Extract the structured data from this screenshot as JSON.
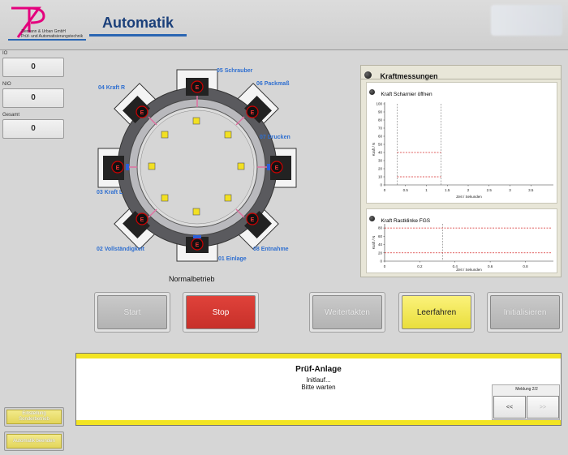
{
  "header": {
    "title": "Automatik",
    "company_line1": "Ziemann & Urban GmbH",
    "company_line2": "Prüf- und Automatisierungstechnik",
    "logo_letters": "ZU",
    "brand_color": "#e4007d",
    "accent_color": "#2a66b3"
  },
  "counters": [
    {
      "label": "IO",
      "value": "0"
    },
    {
      "label": "NIO",
      "value": "0"
    },
    {
      "label": "Gesamt",
      "value": "0"
    }
  ],
  "stations": {
    "s01": "01 Einlage",
    "s02": "02 Vollständigkeit",
    "s03": "03 Kraft L",
    "s04": "04 Kraft R",
    "s05": "05 Schrauber",
    "s06": "06 Packmaß",
    "s07": "07 Drucken",
    "s08": "08 Entnahme",
    "marker": "E"
  },
  "mode": "Normalbetrieb",
  "charts_panel": {
    "title": "Kraftmessungen",
    "chart1": {
      "title": "Kraft Scharnier öffnen",
      "ylabel": "Kraft / N",
      "xlabel": "Zeit / Sekunden",
      "yticks": [
        "100",
        "90",
        "80",
        "70",
        "60",
        "50",
        "40",
        "30",
        "20",
        "10",
        "0"
      ],
      "xticks": [
        "0",
        "0.5",
        "1",
        "1.5",
        "2",
        "2.5",
        "3",
        "3.5"
      ]
    },
    "chart2": {
      "title": "Kraft Rastklinke FGS",
      "ylabel": "Kraft / N",
      "xlabel": "Zeit / Sekunden",
      "yticks": [
        "80",
        "60",
        "40",
        "20",
        "0"
      ],
      "xticks": [
        "0",
        "0.2",
        "0.4",
        "0.6",
        "0.8"
      ]
    }
  },
  "chart_data": [
    {
      "type": "line",
      "title": "Kraft Scharnier öffnen",
      "xlabel": "Zeit / Sekunden",
      "ylabel": "Kraft / N",
      "xlim": [
        0,
        4
      ],
      "ylim": [
        0,
        100
      ],
      "limits": {
        "v_min": 0.3,
        "v_max": 1.35,
        "h_upper": 40,
        "h_lower": 10
      },
      "series": []
    },
    {
      "type": "line",
      "title": "Kraft Rastklinke FGS",
      "xlabel": "Zeit / Sekunden",
      "ylabel": "Kraft / N",
      "xlim": [
        0,
        0.95
      ],
      "ylim": [
        0,
        90
      ],
      "limits": {
        "h_upper": 80,
        "h_lower": 20,
        "v_min": 0.33
      },
      "series": []
    }
  ],
  "buttons": {
    "start": "Start",
    "stop": "Stop",
    "weitertakten": "Weitertakten",
    "leerfahren": "Leerfahren",
    "initialisieren": "Initialisieren"
  },
  "message": {
    "title": "Prüf-Anlage",
    "line1": "Initlauf...",
    "line2": "Bitte warten",
    "meldung": "Meldung 2/2",
    "prev": "<<",
    "next": ">>"
  },
  "side_buttons": {
    "einstellung": "Einstellung Sonderbetrieb",
    "beenden": "Automatik beenden"
  }
}
